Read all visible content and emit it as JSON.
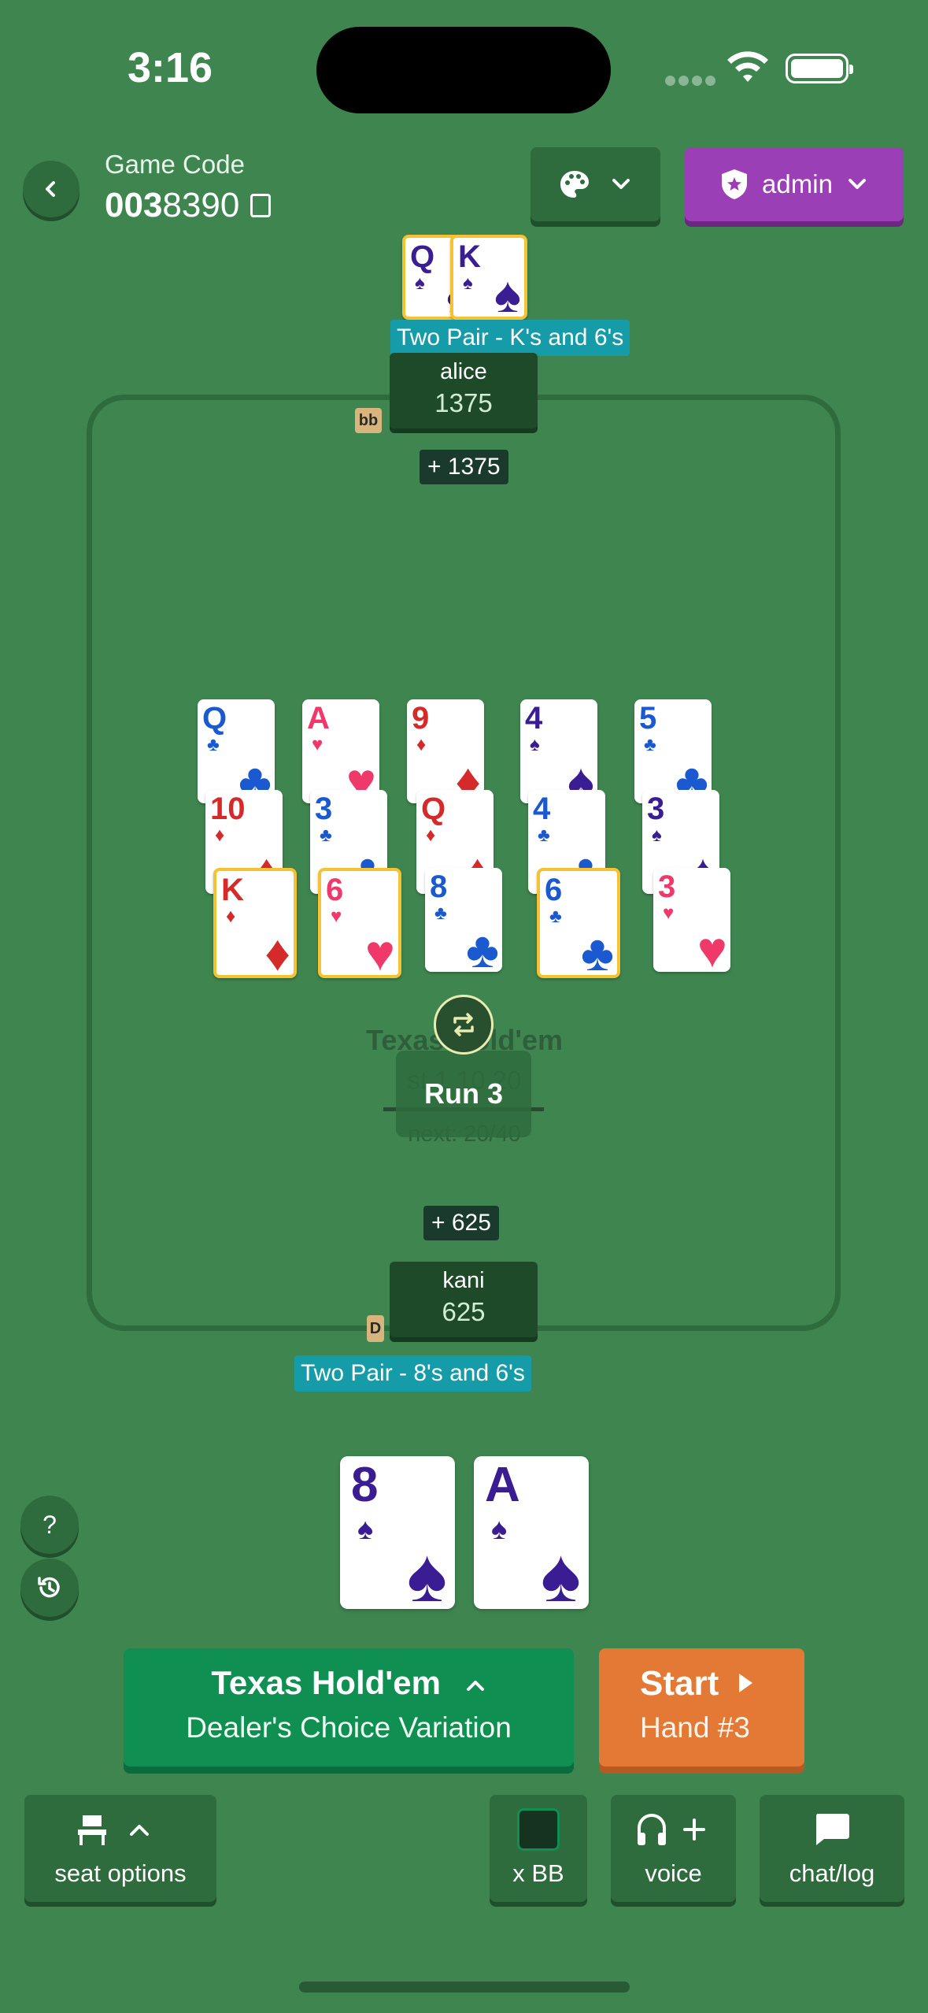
{
  "status": {
    "time": "3:16"
  },
  "header": {
    "game_code_label": "Game Code",
    "game_code_bold": "003",
    "game_code_rest": "8390",
    "user_label": "admin"
  },
  "players": {
    "top": {
      "name": "alice",
      "stack": "1375",
      "badge": "bb",
      "hand": "Two Pair - K's and 6's",
      "pot_win": "+ 1375"
    },
    "bottom": {
      "name": "kani",
      "stack": "625",
      "badge": "D",
      "hand": "Two Pair - 8's and 6's",
      "pot_win": "+ 625"
    }
  },
  "top_hole_cards": [
    {
      "rank": "Q",
      "suit": "♠",
      "color": "#3a1d92"
    },
    {
      "rank": "K",
      "suit": "♠",
      "color": "#3a1d92"
    }
  ],
  "board_runs": [
    [
      {
        "rank": "Q",
        "suit": "♣",
        "color": "#1a59cf",
        "hl": false
      },
      {
        "rank": "A",
        "suit": "♥",
        "color": "#f0396b",
        "hl": false
      },
      {
        "rank": "9",
        "suit": "♦",
        "color": "#d42a2a",
        "hl": false
      },
      {
        "rank": "4",
        "suit": "♠",
        "color": "#3a1d92",
        "hl": false
      },
      {
        "rank": "5",
        "suit": "♣",
        "color": "#1a59cf",
        "hl": false
      }
    ],
    [
      {
        "rank": "10",
        "suit": "♦",
        "color": "#d42a2a",
        "hl": false
      },
      {
        "rank": "3",
        "suit": "♣",
        "color": "#1a59cf",
        "hl": false
      },
      {
        "rank": "Q",
        "suit": "♦",
        "color": "#d42a2a",
        "hl": false
      },
      {
        "rank": "4",
        "suit": "♣",
        "color": "#1a59cf",
        "hl": false
      },
      {
        "rank": "3",
        "suit": "♠",
        "color": "#3a1d92",
        "hl": false
      }
    ],
    [
      {
        "rank": "K",
        "suit": "♦",
        "color": "#d42a2a",
        "hl": true
      },
      {
        "rank": "6",
        "suit": "♥",
        "color": "#f0396b",
        "hl": true
      },
      {
        "rank": "8",
        "suit": "♣",
        "color": "#1a59cf",
        "hl": false
      },
      {
        "rank": "6",
        "suit": "♣",
        "color": "#1a59cf",
        "hl": true
      },
      {
        "rank": "3",
        "suit": "♥",
        "color": "#f0396b",
        "hl": false
      }
    ]
  ],
  "center": {
    "game_name": "Texas Hold'em",
    "stakes": "st 1 10 20",
    "next": "next: 20/40",
    "run_label": "Run 3"
  },
  "my_hole_cards": [
    {
      "rank": "8",
      "suit": "♠",
      "color": "#3a1d92"
    },
    {
      "rank": "A",
      "suit": "♠",
      "color": "#3a1d92"
    }
  ],
  "side_buttons": {
    "help": "?"
  },
  "game_button": {
    "title": "Texas Hold'em",
    "subtitle": "Dealer's Choice Variation"
  },
  "start_button": {
    "title": "Start",
    "subtitle": "Hand #3"
  },
  "toolbar": {
    "seat_options": "seat options",
    "xbb": "x BB",
    "voice": "voice",
    "chat": "chat/log"
  },
  "colors": {
    "felt": "#3f8550",
    "highlight": "#f5c232",
    "hand_label": "#169ca8",
    "admin": "#9a3fb5",
    "start": "#e37935",
    "game_button": "#0f8f52"
  }
}
